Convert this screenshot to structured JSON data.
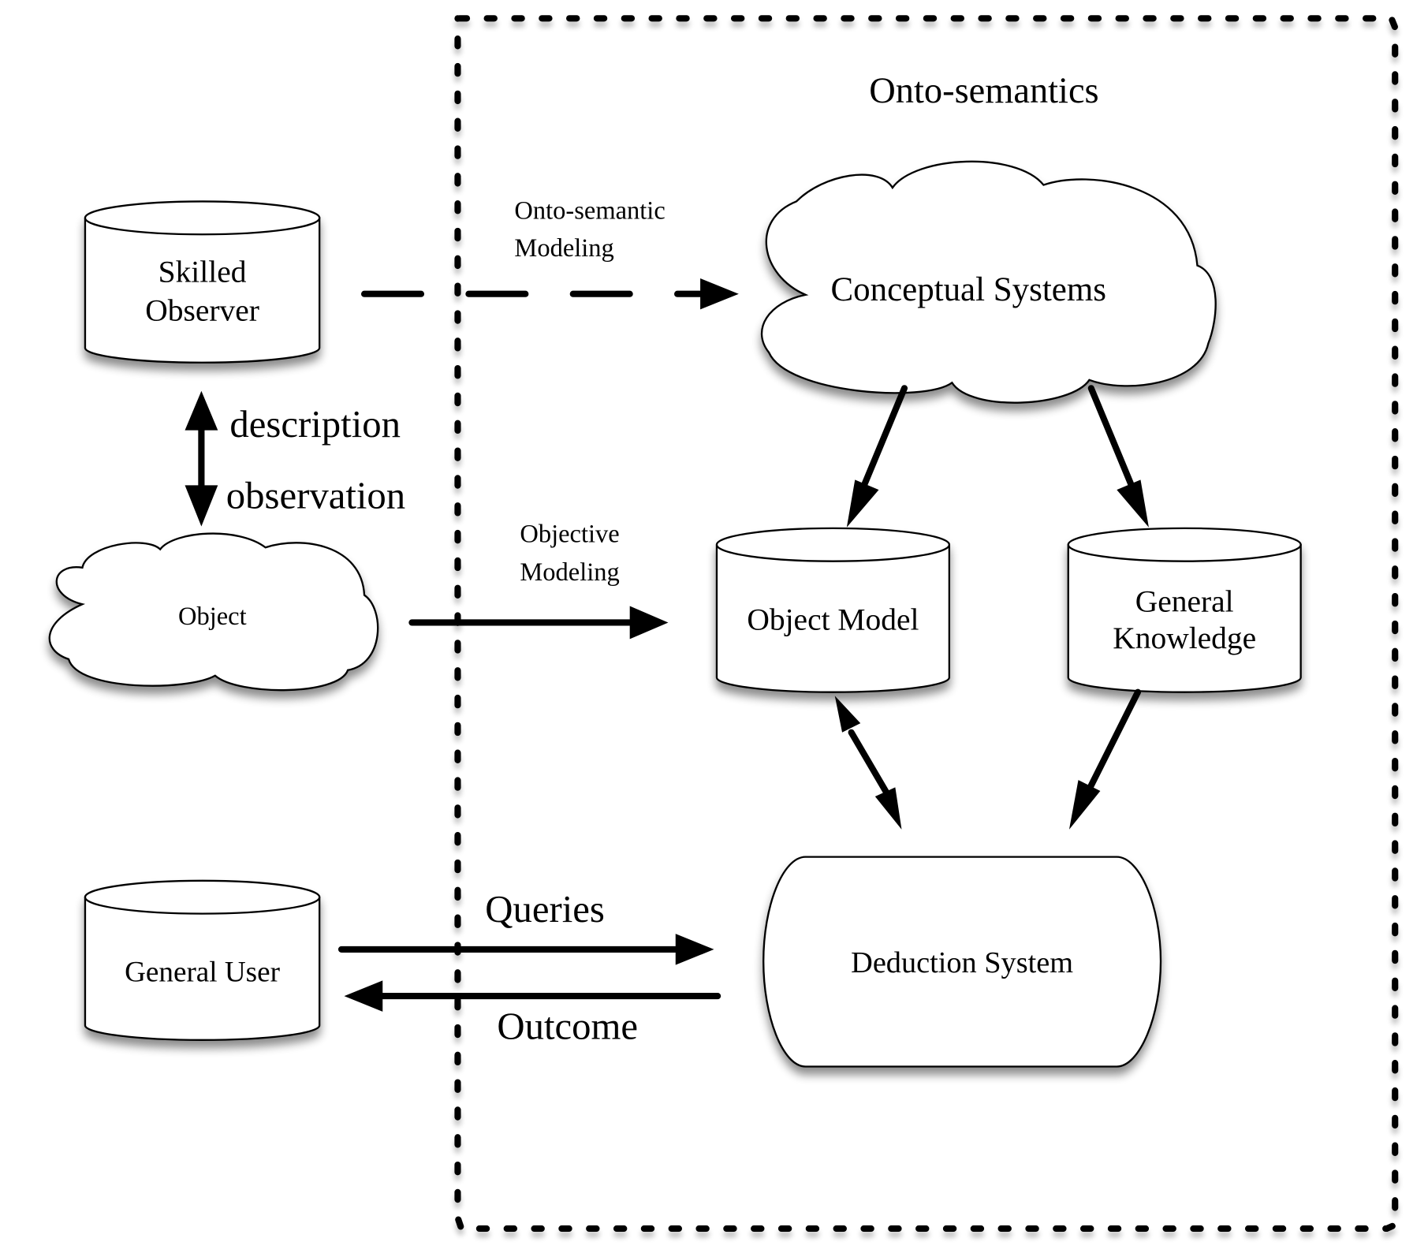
{
  "diagram": {
    "boundary_label": "Onto-semantics",
    "nodes": {
      "skilled_observer": {
        "label_lines": [
          "Skilled",
          "Observer"
        ],
        "shape": "cylinder"
      },
      "object": {
        "label": "Object",
        "shape": "cloud"
      },
      "general_user": {
        "label": "General User",
        "shape": "cylinder"
      },
      "conceptual_systems": {
        "label": "Conceptual Systems",
        "shape": "cloud"
      },
      "object_model": {
        "label": "Object Model",
        "shape": "cylinder"
      },
      "general_knowledge": {
        "label_lines": [
          "General",
          "Knowledge"
        ],
        "shape": "cylinder"
      },
      "deduction_system": {
        "label": "Deduction System",
        "shape": "rounded-barrel"
      }
    },
    "edges": {
      "onto_semantic_modeling": {
        "label_lines": [
          "Onto-semantic",
          "Modeling"
        ],
        "from": "Skilled Observer",
        "to": "Conceptual Systems",
        "style": "dashed"
      },
      "description_observation": {
        "label_top": "description",
        "label_bottom": "observation",
        "from": "Skilled Observer",
        "to": "Object",
        "style": "bidirectional"
      },
      "objective_modeling": {
        "label_lines": [
          "Objective",
          "Modeling"
        ],
        "from": "Object",
        "to": "Object Model",
        "style": "solid"
      },
      "cs_to_object_model": {
        "from": "Conceptual Systems",
        "to": "Object Model",
        "style": "solid"
      },
      "cs_to_general_knowledge": {
        "from": "Conceptual Systems",
        "to": "General Knowledge",
        "style": "solid"
      },
      "object_model_deduction": {
        "from": "Object Model",
        "to": "Deduction System",
        "style": "bidirectional"
      },
      "knowledge_to_deduction": {
        "from": "General Knowledge",
        "to": "Deduction System",
        "style": "solid"
      },
      "queries": {
        "label": "Queries",
        "from": "General User",
        "to": "Deduction System",
        "style": "solid"
      },
      "outcome": {
        "label": "Outcome",
        "from": "Deduction System",
        "to": "General User",
        "style": "solid"
      }
    }
  }
}
